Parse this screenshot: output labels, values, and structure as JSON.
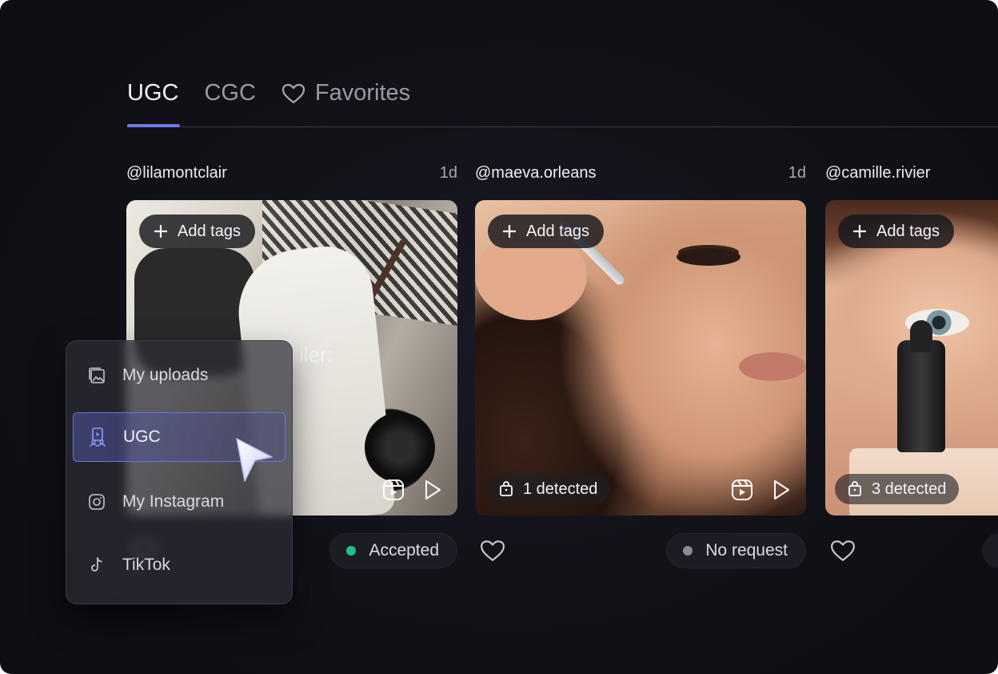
{
  "tabs": [
    {
      "label": "UGC",
      "active": true
    },
    {
      "label": "CGC",
      "active": false
    },
    {
      "label": "Favorites",
      "active": false,
      "icon": "heart-outline-icon"
    }
  ],
  "cards": [
    {
      "handle": "@lilamontclair",
      "age": "1d",
      "add_tags_label": "Add tags",
      "image_caption": "iler:",
      "status": "Accepted",
      "status_color": "#1fbf8f"
    },
    {
      "handle": "@maeva.orleans",
      "age": "1d",
      "add_tags_label": "Add tags",
      "detected": "1 detected",
      "status": "No request",
      "status_color": "#8c8c96"
    },
    {
      "handle": "@camille.rivier",
      "add_tags_label": "Add tags",
      "detected": "3 detected"
    }
  ],
  "source_menu": {
    "items": [
      {
        "label": "My uploads",
        "icon": "image-gallery-icon",
        "selected": false
      },
      {
        "label": "UGC",
        "icon": "ugc-creator-icon",
        "selected": true
      },
      {
        "label": "My Instagram",
        "icon": "instagram-icon",
        "selected": false
      },
      {
        "label": "TikTok",
        "icon": "tiktok-icon",
        "selected": false
      }
    ]
  },
  "colors": {
    "background": "#121219",
    "accent": "#6f79e6",
    "accepted": "#1fbf8f",
    "no_request": "#8c8c96"
  }
}
